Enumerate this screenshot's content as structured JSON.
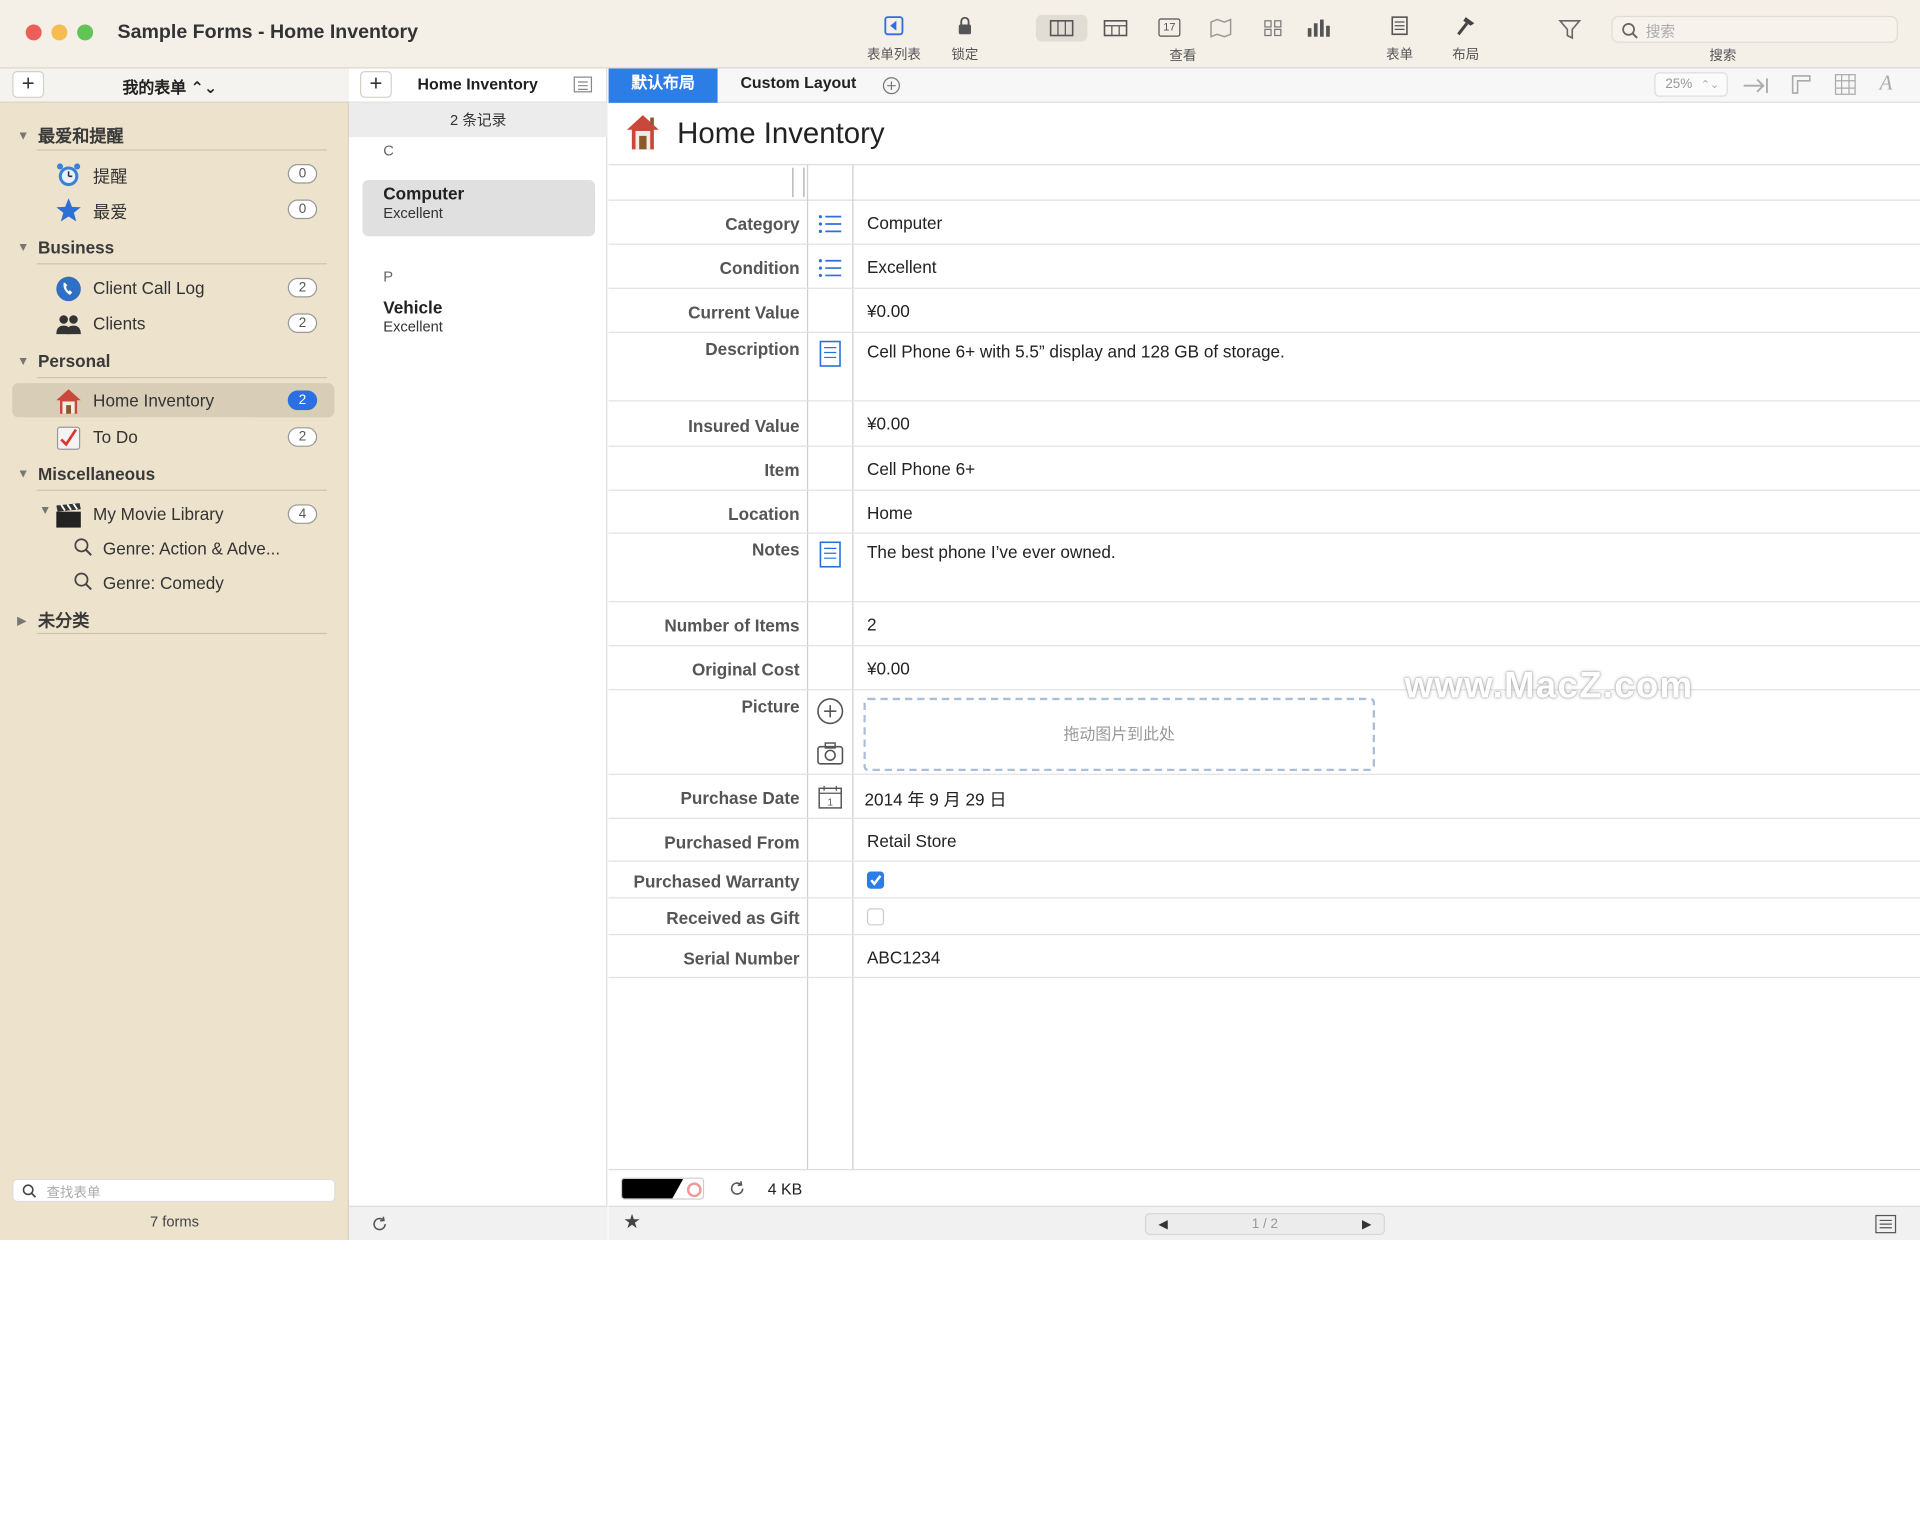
{
  "window": {
    "title": "Sample Forms - Home Inventory"
  },
  "toolbar": {
    "form_list_label": "表单列表",
    "lock_label": "锁定",
    "view_label": "查看",
    "form_label": "表单",
    "layout_label": "布局",
    "search_label": "搜索",
    "search_placeholder": "搜索",
    "calendar_day": "17"
  },
  "sidebar": {
    "header_title": "我的表单 ⌃⌄",
    "sections": [
      {
        "title": "最爱和提醒"
      },
      {
        "title": "Business"
      },
      {
        "title": "Personal"
      },
      {
        "title": "Miscellaneous"
      },
      {
        "title": "未分类"
      }
    ],
    "items": [
      {
        "label": "提醒",
        "count": "0"
      },
      {
        "label": "最爱",
        "count": "0"
      },
      {
        "label": "Client Call Log",
        "count": "2"
      },
      {
        "label": "Clients",
        "count": "2"
      },
      {
        "label": "Home Inventory",
        "count": "2"
      },
      {
        "label": "To Do",
        "count": "2"
      },
      {
        "label": "My Movie Library",
        "count": "4"
      },
      {
        "label": "Genre: Action & Adve..."
      },
      {
        "label": "Genre: Comedy"
      }
    ],
    "search_placeholder": "查找表单",
    "forms_count": "7 forms"
  },
  "list": {
    "title": "Home Inventory",
    "record_count": "2 条记录",
    "groups": [
      {
        "letter": "C",
        "records": [
          {
            "name": "Computer",
            "sub": "Excellent"
          }
        ]
      },
      {
        "letter": "P",
        "records": [
          {
            "name": "Vehicle",
            "sub": "Excellent"
          }
        ]
      }
    ]
  },
  "tabs": {
    "default_label": "默认布局",
    "custom_label": "Custom Layout"
  },
  "zoom": "25%",
  "form": {
    "title": "Home Inventory",
    "fields": [
      {
        "label": "Category",
        "value": "Computer"
      },
      {
        "label": "Condition",
        "value": "Excellent"
      },
      {
        "label": "Current Value",
        "value": "¥0.00"
      },
      {
        "label": "Description",
        "value": "Cell Phone 6+ with 5.5” display and 128 GB of storage."
      },
      {
        "label": "Insured Value",
        "value": "¥0.00"
      },
      {
        "label": "Item",
        "value": "Cell Phone 6+"
      },
      {
        "label": "Location",
        "value": "Home"
      },
      {
        "label": "Notes",
        "value": "The best phone I’ve ever owned."
      },
      {
        "label": "Number of Items",
        "value": "2"
      },
      {
        "label": "Original Cost",
        "value": "¥0.00"
      },
      {
        "label": "Picture",
        "value": "拖动图片到此处"
      },
      {
        "label": "Purchase Date",
        "value": "2014 年 9 月 29 日"
      },
      {
        "label": "Purchased From",
        "value": "Retail Store"
      },
      {
        "label": "Purchased Warranty",
        "checked": true
      },
      {
        "label": "Received as Gift",
        "checked": false
      },
      {
        "label": "Serial Number",
        "value": "ABC1234"
      }
    ]
  },
  "footer": {
    "size": "4 KB",
    "pager": "1 / 2"
  },
  "watermark": "www.MacZ.com",
  "colors": {
    "accent": "#2c7de5",
    "sidebar_bg": "#ede3cc",
    "titlebar_bg": "#f4efe7"
  }
}
